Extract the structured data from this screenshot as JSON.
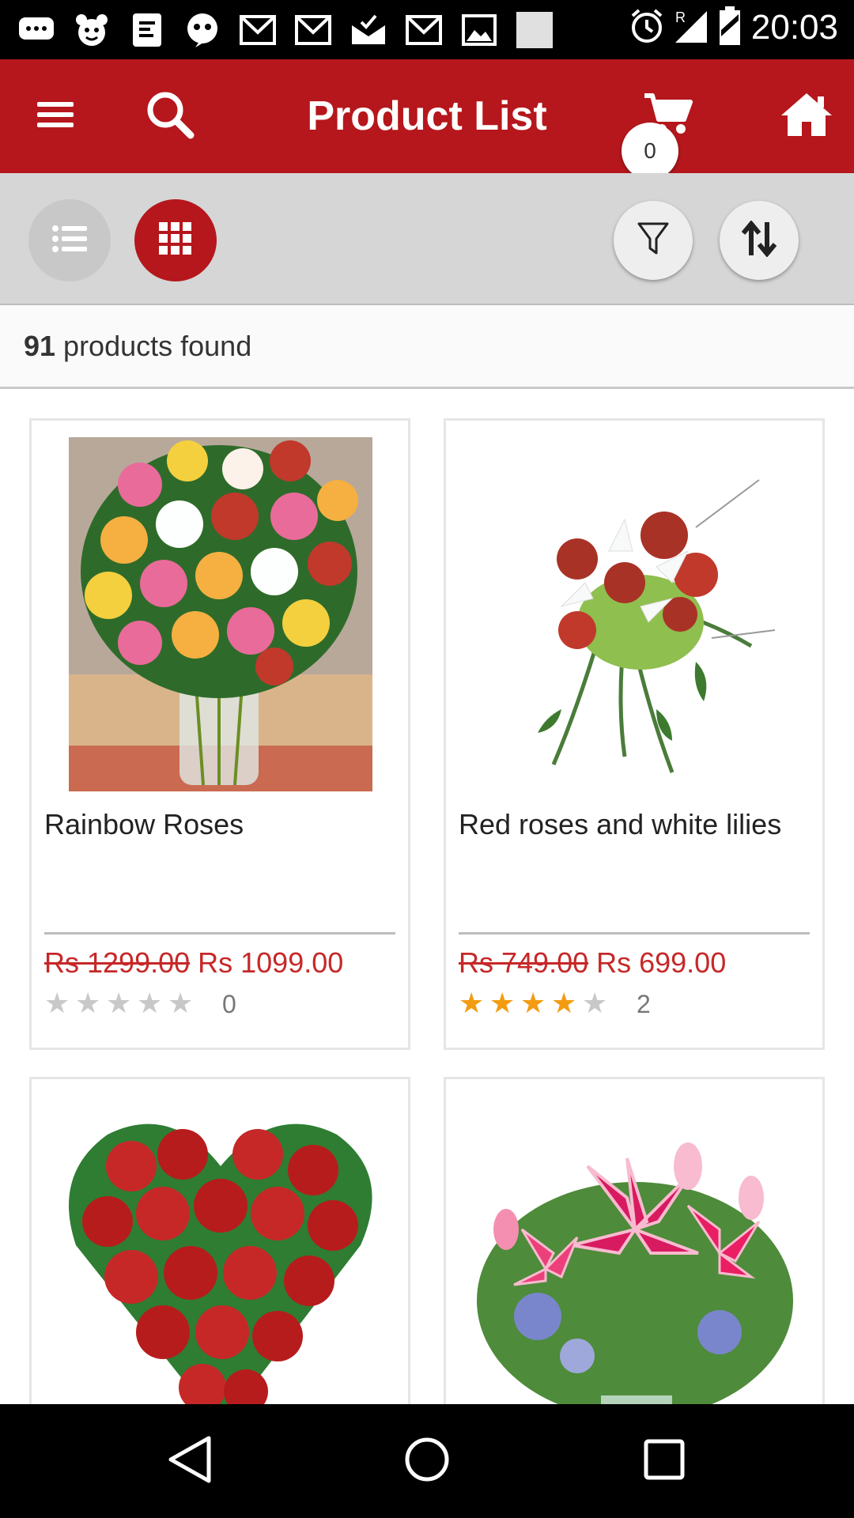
{
  "status_bar": {
    "time": "20:03",
    "icons": [
      "chat-icon",
      "bear-icon",
      "document-icon",
      "quote-icon",
      "gmail-icon",
      "gmail-icon",
      "mail-check-icon",
      "gmail-icon",
      "image-icon",
      "blank-square-icon"
    ],
    "right_icons": [
      "alarm-icon",
      "signal-icon",
      "battery-icon"
    ]
  },
  "app_bar": {
    "title": "Product List",
    "cart_count": "0",
    "icons": {
      "menu": "menu-icon",
      "search": "search-icon",
      "cart": "cart-icon",
      "home": "home-icon"
    },
    "color": "#b5171c"
  },
  "toolbar": {
    "list_view": "list-view-icon",
    "grid_view": "grid-view-icon",
    "filter": "filter-icon",
    "sort": "sort-icon",
    "active_view": "grid"
  },
  "results": {
    "count": "91",
    "label": "products found"
  },
  "products": [
    {
      "name": "Rainbow Roses",
      "old_price": "Rs 1299.00",
      "price": "Rs 1099.00",
      "rating": 0,
      "review_count": "0",
      "image": "rainbow roses bouquet in glass vase"
    },
    {
      "name": "Red roses and white lilies",
      "old_price": "Rs 749.00",
      "price": "Rs 699.00",
      "rating": 4,
      "review_count": "2",
      "image": "red roses and white lilies bouquet"
    },
    {
      "name": "",
      "image": "heart shaped red roses arrangement"
    },
    {
      "name": "",
      "image": "pink stargazer lilies arrangement"
    }
  ],
  "colors": {
    "accent": "#b5171c",
    "price": "#c62828",
    "star_on": "#f39c12",
    "star_off": "#c8c8c8"
  },
  "nav_bar": {
    "icons": [
      "back-icon",
      "home-circle-icon",
      "recents-icon"
    ]
  }
}
